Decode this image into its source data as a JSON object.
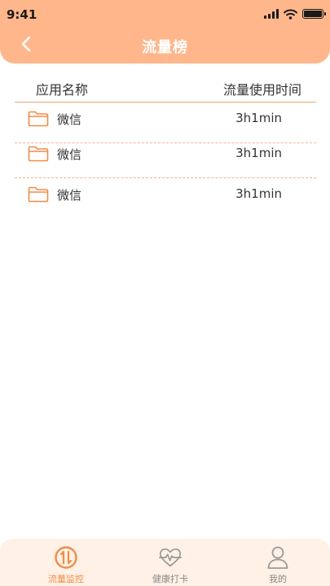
{
  "status_bar": {
    "time": "9:41"
  },
  "header": {
    "title": "流量榜"
  },
  "table": {
    "columns": {
      "app_name": "应用名称",
      "usage_time": "流量使用时间"
    },
    "rows": [
      {
        "name": "微信",
        "time": "3h1min"
      },
      {
        "name": "微信",
        "time": "3h1min"
      },
      {
        "name": "微信",
        "time": "3h1min"
      }
    ]
  },
  "tabbar": {
    "items": [
      {
        "label": "流量监控",
        "icon": "traffic-icon",
        "active": true
      },
      {
        "label": "健康打卡",
        "icon": "heartbeat-icon",
        "active": false
      },
      {
        "label": "我的",
        "icon": "user-icon",
        "active": false
      }
    ]
  },
  "colors": {
    "accent": "#ffb68a",
    "accent_dark": "#f08c46",
    "tab_bg": "#fff1e5",
    "divider": "#f3a070"
  }
}
